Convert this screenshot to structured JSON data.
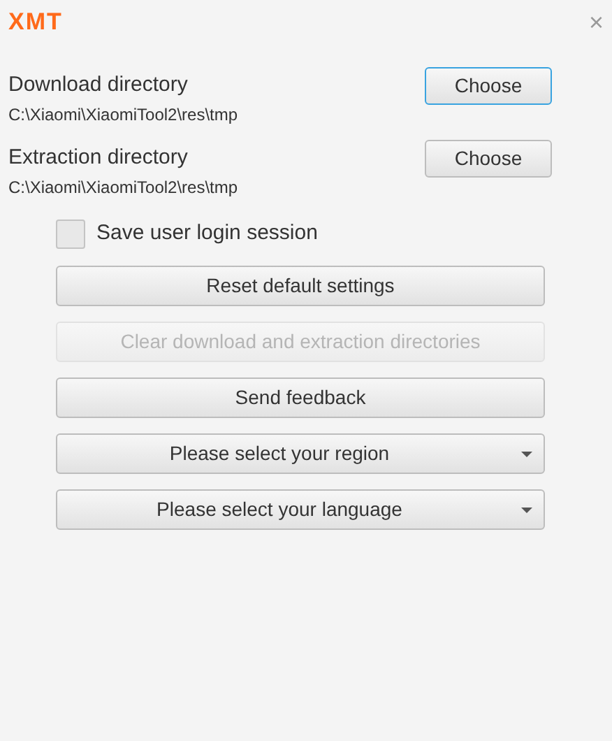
{
  "window": {
    "logo": "XMT",
    "close": "×"
  },
  "directories": [
    {
      "label": "Download directory",
      "path": "C:\\Xiaomi\\XiaomiTool2\\res\\tmp",
      "button": "Choose",
      "focused": true
    },
    {
      "label": "Extraction directory",
      "path": "C:\\Xiaomi\\XiaomiTool2\\res\\tmp",
      "button": "Choose",
      "focused": false
    }
  ],
  "save_session": {
    "label": "Save user login session",
    "checked": false
  },
  "actions": [
    {
      "kind": "button",
      "label": "Reset default settings",
      "disabled": false
    },
    {
      "kind": "button",
      "label": "Clear download and extraction directories",
      "disabled": true
    },
    {
      "kind": "button",
      "label": "Send feedback",
      "disabled": false
    },
    {
      "kind": "dropdown",
      "label": "Please select your region",
      "disabled": false
    },
    {
      "kind": "dropdown",
      "label": "Please select your language",
      "disabled": false
    }
  ]
}
